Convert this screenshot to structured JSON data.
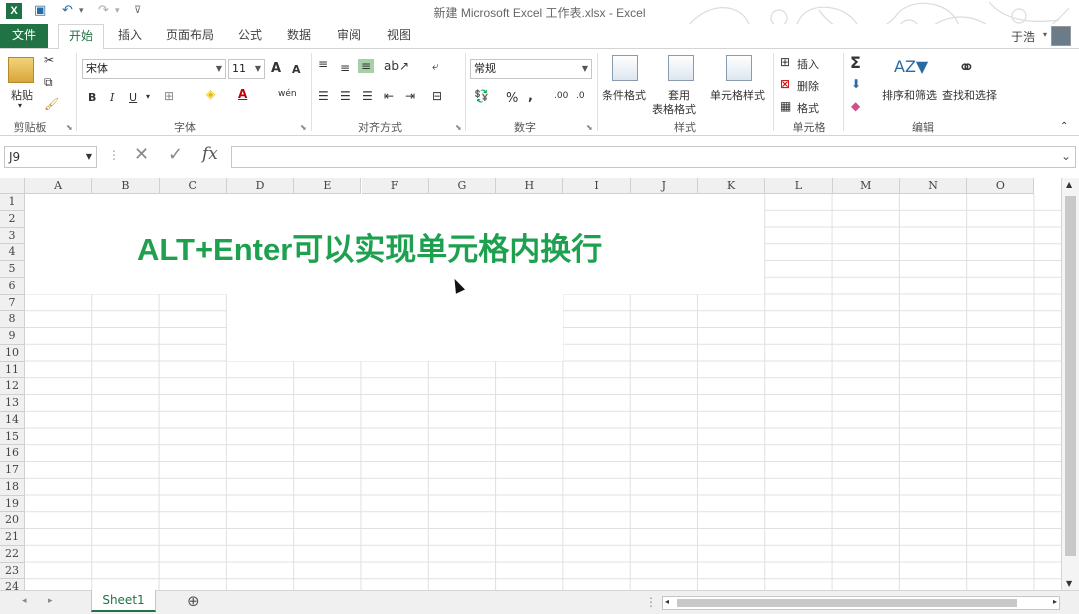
{
  "window": {
    "title": "新建 Microsoft Excel 工作表.xlsx - Excel"
  },
  "tabs": [
    "文件",
    "开始",
    "插入",
    "页面布局",
    "公式",
    "数据",
    "审阅",
    "视图"
  ],
  "active_tab": "开始",
  "user": "于浩",
  "ribbon": {
    "clipboard": {
      "paste": "粘贴",
      "label": "剪贴板"
    },
    "font": {
      "name": "宋体",
      "size": "11",
      "label": "字体",
      "bold": "B",
      "italic": "I",
      "underline": "U",
      "grow": "A",
      "shrink": "A",
      "phonetic": "wén"
    },
    "alignment": {
      "label": "对齐方式"
    },
    "number": {
      "format": "常规",
      "label": "数字",
      "percent": "%",
      "comma": ","
    },
    "styles": {
      "cond": "条件格式",
      "table_a": "套用",
      "table_b": "表格格式",
      "cell_style": "单元格样式",
      "label": "样式"
    },
    "cells": {
      "insert": "插入",
      "delete": "删除",
      "format": "格式",
      "label": "单元格"
    },
    "editing": {
      "sum": "Σ",
      "sort": "排序和筛选",
      "find": "查找和选择",
      "label": "编辑"
    }
  },
  "formula_bar": {
    "name_box": "J9",
    "fx": "fx",
    "value": ""
  },
  "columns": [
    "A",
    "B",
    "C",
    "D",
    "E",
    "F",
    "G",
    "H",
    "I",
    "J",
    "K",
    "L",
    "M",
    "N",
    "O"
  ],
  "rows": [
    "1",
    "2",
    "3",
    "4",
    "5",
    "6",
    "7",
    "8",
    "9",
    "10",
    "11",
    "12",
    "13",
    "14",
    "15",
    "16",
    "17",
    "18",
    "19",
    "20",
    "21",
    "22",
    "23",
    "24"
  ],
  "banner_text": "ALT+Enter可以实现单元格内换行",
  "sheets": [
    "Sheet1"
  ]
}
